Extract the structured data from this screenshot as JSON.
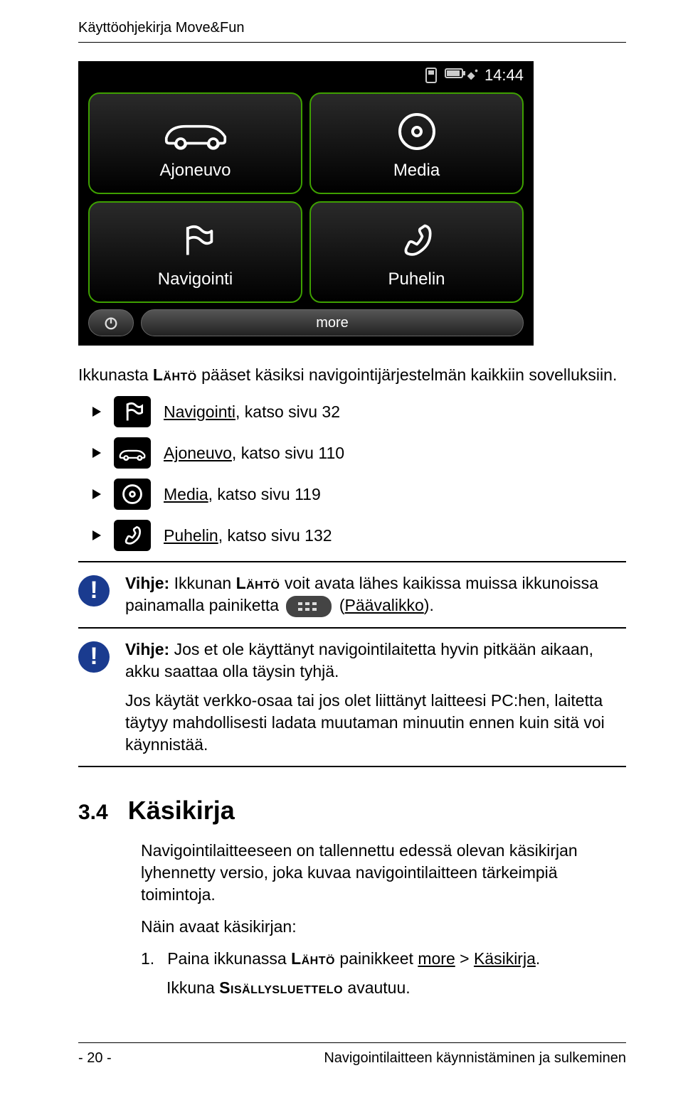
{
  "header": {
    "title": "Käyttöohjekirja Move&Fun"
  },
  "screenshot": {
    "status": {
      "time": "14:44"
    },
    "tiles": [
      {
        "name": "vehicle-tile",
        "label": "Ajoneuvo",
        "icon": "car"
      },
      {
        "name": "media-tile",
        "label": "Media",
        "icon": "disc"
      },
      {
        "name": "nav-tile",
        "label": "Navigointi",
        "icon": "flag"
      },
      {
        "name": "phone-tile",
        "label": "Puhelin",
        "icon": "phone"
      }
    ],
    "bottom": {
      "more": "more"
    }
  },
  "intro": {
    "p1_a": "Ikkunasta ",
    "p1_sc": "Lähtö",
    "p1_b": " pääset käsiksi navigointijärjestelmän kaikkiin sovelluksiin."
  },
  "refs": [
    {
      "name": "ref-navigointi",
      "icon": "flag",
      "label": "Navigointi",
      "suffix": ", katso sivu 32"
    },
    {
      "name": "ref-ajoneuvo",
      "icon": "car",
      "label": "Ajoneuvo",
      "suffix": ", katso sivu 110"
    },
    {
      "name": "ref-media",
      "icon": "disc",
      "label": "Media",
      "suffix": ", katso sivu 119"
    },
    {
      "name": "ref-puhelin",
      "icon": "phone",
      "label": "Puhelin",
      "suffix": ", katso sivu 132"
    }
  ],
  "hint1": {
    "a": "Vihje:",
    "b": " Ikkunan ",
    "sc": "Lähtö",
    "c": " voit avata lähes kaikissa muissa ikkunoissa painamalla painiketta ",
    "d": " (",
    "e": "Päävalikko",
    "f": ")."
  },
  "hint2": {
    "a": "Vihje:",
    "b": " Jos et ole käyttänyt navigointilaitetta hyvin pitkään aikaan, akku saattaa olla täysin tyhjä.",
    "c": "Jos käytät verkko-osaa tai jos olet liittänyt laitteesi PC:hen, laitetta täytyy mahdollisesti ladata muutaman minuutin ennen kuin sitä voi käynnistää."
  },
  "section": {
    "num": "3.4",
    "title": "Käsikirja"
  },
  "section_body": {
    "p1": "Navigointilaitteeseen on tallennettu edessä olevan käsikirjan lyhennetty versio, joka kuvaa navigointilaitteen tärkeimpiä toimintoja.",
    "p2": "Näin avaat käsikirjan:",
    "li_num": "1.",
    "li_a": "Paina ikkunassa ",
    "li_sc1": "Lähtö",
    "li_b": " painikkeet ",
    "li_u1": "more",
    "li_c": " > ",
    "li_u2": "Käsikirja",
    "li_d": ".",
    "p3_a": "Ikkuna ",
    "p3_sc": "Sisällysluettelo",
    "p3_b": " avautuu."
  },
  "footer": {
    "left": "- 20 -",
    "right": "Navigointilaitteen käynnistäminen ja sulkeminen"
  }
}
